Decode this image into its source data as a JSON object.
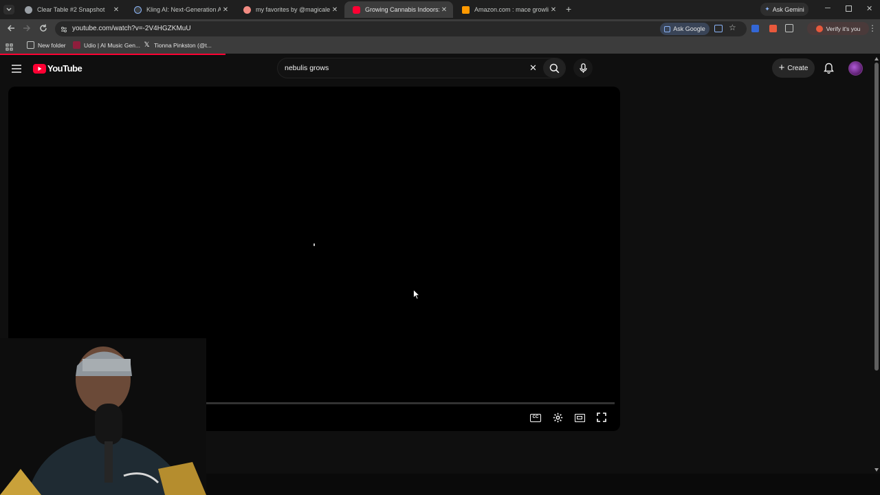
{
  "browser": {
    "tabs": [
      {
        "title": "Clear Table #2 Snapshot",
        "favicon_color": "#9aa0a6",
        "active": false
      },
      {
        "title": "Kling AI: Next-Generation AI Cr",
        "favicon_color": "#8ab4f8",
        "active": false
      },
      {
        "title": "my favorites by @magicalelecti",
        "favicon_color": "#f28b82",
        "active": false
      },
      {
        "title": "Growing Cannabis Indoors: We",
        "favicon_color": "#ff0033",
        "active": true
      },
      {
        "title": "Amazon.com : mace growlight",
        "favicon_color": "#ff9900",
        "active": false
      }
    ],
    "ask_gemini": "Ask Gemini",
    "url": "youtube.com/watch?v=-2V4HGZKMuU",
    "ask_google": "Ask Google",
    "verify": "Verify it's you",
    "bookmarks": [
      {
        "label": "New folder"
      },
      {
        "label": "Udio | AI Music Gen..."
      },
      {
        "label": "Tionna Pinkston (@t..."
      }
    ],
    "load_progress": 0.256
  },
  "youtube": {
    "logo_text": "YouTube",
    "search_query": "nebulis grows",
    "create_label": "Create",
    "accent": "#ff0033"
  },
  "player": {
    "playing": true,
    "progress": 0.0
  }
}
